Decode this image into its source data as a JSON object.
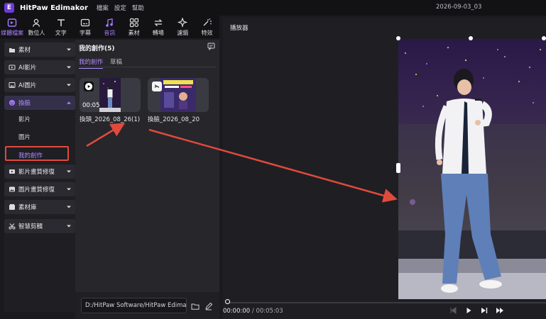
{
  "app": {
    "name": "HitPaw Edimakor",
    "menu": [
      "檔案",
      "設定",
      "幫助"
    ],
    "window_title": "2026-09-03_03"
  },
  "toolbar": {
    "items": [
      {
        "label": "媒體檔案",
        "icon": "media-icon",
        "active": true
      },
      {
        "label": "數位人",
        "icon": "avatar-icon"
      },
      {
        "label": "文字",
        "icon": "text-icon"
      },
      {
        "label": "字幕",
        "icon": "subtitle-icon"
      },
      {
        "label": "音訊",
        "icon": "music-icon"
      },
      {
        "label": "素材",
        "icon": "stickers-icon"
      },
      {
        "label": "轉場",
        "icon": "transition-icon"
      },
      {
        "label": "濾鏡",
        "icon": "filter-icon"
      },
      {
        "label": "特效",
        "icon": "effects-icon"
      }
    ]
  },
  "sidebar": {
    "items": [
      {
        "label": "素材"
      },
      {
        "label": "AI影片"
      },
      {
        "label": "AI圖片"
      },
      {
        "label": "換臉"
      },
      {
        "label": "影片畫質修復"
      },
      {
        "label": "圖片畫質修復"
      },
      {
        "label": "素材庫"
      },
      {
        "label": "智慧剪輯"
      }
    ],
    "sub_items": [
      "影片",
      "圖片",
      "我的創作"
    ]
  },
  "library": {
    "title": "我的創作(5)",
    "tabs": [
      "我的創作",
      "草稿"
    ],
    "cards": [
      {
        "name": "換頭_2026_08_26(1)",
        "duration": "00:05"
      },
      {
        "name": "換臉_2026_08_20"
      }
    ],
    "path": "D:/HitPaw Software/HitPaw Edimakor"
  },
  "player": {
    "title": "播放器",
    "current_time": "00:00:00",
    "total_time": "/ 00:05:03"
  },
  "colors": {
    "accent": "#a77bff",
    "highlight_box": "#e04a3c",
    "arrow": "#e04a3c"
  }
}
